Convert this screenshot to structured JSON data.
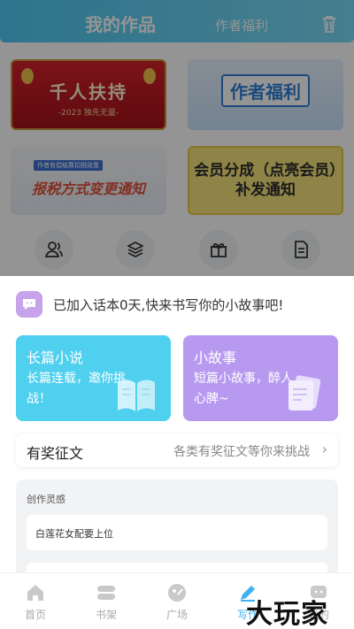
{
  "header": {
    "tab_works": "我的作品",
    "tab_benefits": "作者福利"
  },
  "banners": [
    {
      "title": "千人扶持",
      "subtitle": "-2023 独先无量-"
    },
    {
      "title": "作者福利"
    },
    {
      "tag": "作者有偿结算扣税政策",
      "title_a": "报税方式",
      "title_b": "变更通知"
    },
    {
      "title": "会员分成（点亮会员）补发通知"
    }
  ],
  "notice": {
    "text": "已加入话本0天,快来书写你的小故事吧!"
  },
  "cards": {
    "novel": {
      "title": "长篇小说",
      "subtitle": "长篇连载，邀你挑战！"
    },
    "story": {
      "title": "小故事",
      "subtitle": "短篇小故事，醉人心脾~"
    }
  },
  "contest": {
    "title": "有奖征文",
    "desc": "各类有奖征文等你来挑战",
    "arrow": "›"
  },
  "inspiration": {
    "title": "创作灵感",
    "items": [
      "白莲花女配要上位"
    ]
  },
  "nav": {
    "items": [
      {
        "label": "首页",
        "icon": "home-icon"
      },
      {
        "label": "书架",
        "icon": "bookshelf-icon"
      },
      {
        "label": "广场",
        "icon": "square-icon"
      },
      {
        "label": "写作",
        "icon": "write-icon"
      },
      {
        "label": "我的",
        "icon": "profile-icon"
      }
    ],
    "active": "写作"
  },
  "watermark": "大玩家",
  "colors": {
    "accent": "#4fc9f2",
    "novel_card": "#4fd0ee",
    "story_card": "#b79af0",
    "nav_active": "#3fb0f0"
  }
}
